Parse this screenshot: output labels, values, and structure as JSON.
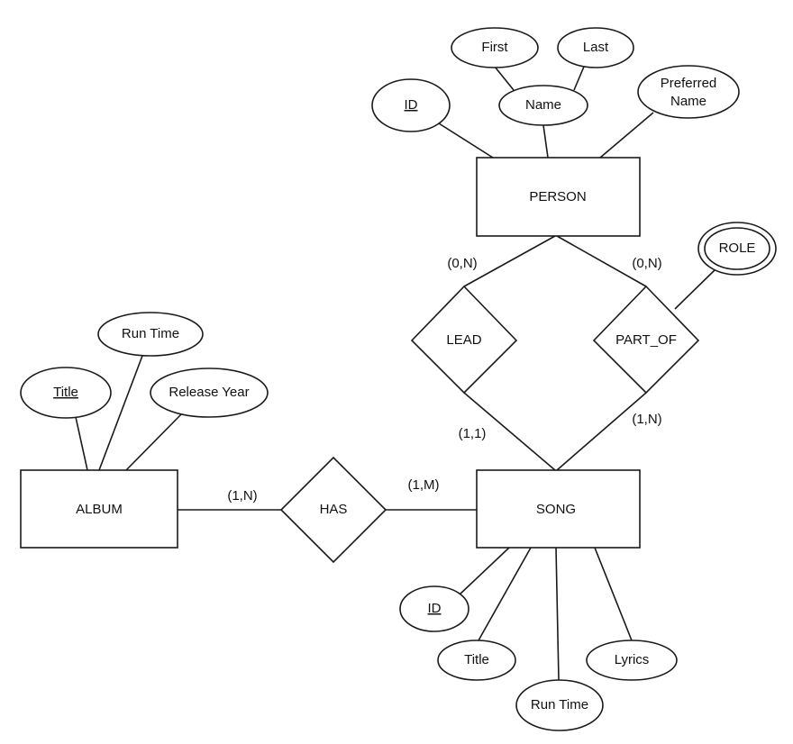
{
  "entities": {
    "person": "PERSON",
    "song": "SONG",
    "album": "ALBUM"
  },
  "relationships": {
    "lead": "LEAD",
    "part_of": "PART_OF",
    "has": "HAS"
  },
  "attributes": {
    "person_id": "ID",
    "person_name": "Name",
    "person_first": "First",
    "person_last": "Last",
    "person_preferred_line1": "Preferred",
    "person_preferred_line2": "Name",
    "role": "ROLE",
    "album_title": "Title",
    "album_run_time": "Run Time",
    "album_release_year": "Release Year",
    "song_id": "ID",
    "song_title": "Title",
    "song_run_time": "Run Time",
    "song_lyrics": "Lyrics"
  },
  "cardinalities": {
    "person_lead": "(0,N)",
    "person_part_of": "(0,N)",
    "lead_song": "(1,1)",
    "part_of_song": "(1,N)",
    "album_has": "(1,N)",
    "has_song": "(1,M)"
  }
}
